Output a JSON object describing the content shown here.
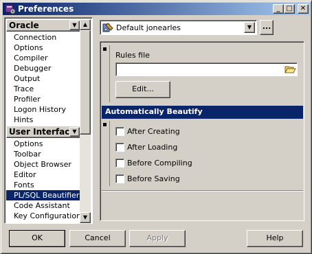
{
  "window": {
    "title": "Preferences"
  },
  "titlebar_buttons": {
    "minimize": "_",
    "maximize": "□",
    "close": "✕"
  },
  "navigator": {
    "groups": [
      {
        "label": "Oracle",
        "items": [
          "Connection",
          "Options",
          "Compiler",
          "Debugger",
          "Output",
          "Trace",
          "Profiler",
          "Logon History",
          "Hints"
        ]
      },
      {
        "label": "User Interface",
        "items": [
          "Options",
          "Toolbar",
          "Object Browser",
          "Editor",
          "Fonts",
          "PL/SQL Beautifier",
          "Code Assistant",
          "Key Configuration"
        ]
      }
    ],
    "selected": "PL/SQL Beautifier"
  },
  "profile": {
    "value": "Default jonearles",
    "ellipsis": "..."
  },
  "rules": {
    "label": "Rules file",
    "value": "",
    "edit_button": "Edit..."
  },
  "auto_beautify": {
    "header": "Automatically Beautify",
    "options": [
      {
        "label": "After Creating",
        "checked": false
      },
      {
        "label": "After Loading",
        "checked": false
      },
      {
        "label": "Before Compiling",
        "checked": false
      },
      {
        "label": "Before Saving",
        "checked": false
      }
    ]
  },
  "buttons": {
    "ok": "OK",
    "cancel": "Cancel",
    "apply": "Apply",
    "help": "Help"
  },
  "icons": {
    "app": "preferences-app-icon",
    "profile": "profile-tools-icon",
    "browse": "folder-open-icon"
  },
  "colors": {
    "selection": "#0a246a",
    "face": "#d4d0c8",
    "title_start": "#0a246a",
    "title_end": "#a6caf0"
  }
}
